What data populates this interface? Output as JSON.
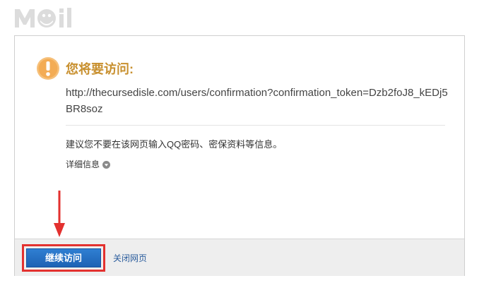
{
  "logo": {
    "text": "MOil",
    "icon": "mail-logo"
  },
  "warning": {
    "icon": "exclamation-circle-icon",
    "title": "您将要访问:",
    "url": "http://thecursedisle.com/users/confirmation?confirmation_token=Dzb2foJ8_kEDj5BR8soz"
  },
  "advice": "建议您不要在该网页输入QQ密码、密保资料等信息。",
  "details": {
    "label": "详细信息",
    "icon": "chevron-down-circle-icon"
  },
  "footer": {
    "continue_label": "继续访问",
    "close_label": "关闭网页"
  },
  "annotation": {
    "arrow_icon": "red-arrow-down-icon",
    "highlight_color": "#e3312f"
  },
  "colors": {
    "title": "#c8902f",
    "warning_icon": "#f3b76a",
    "button": "#1d62b4",
    "link": "#2a5c9c"
  }
}
